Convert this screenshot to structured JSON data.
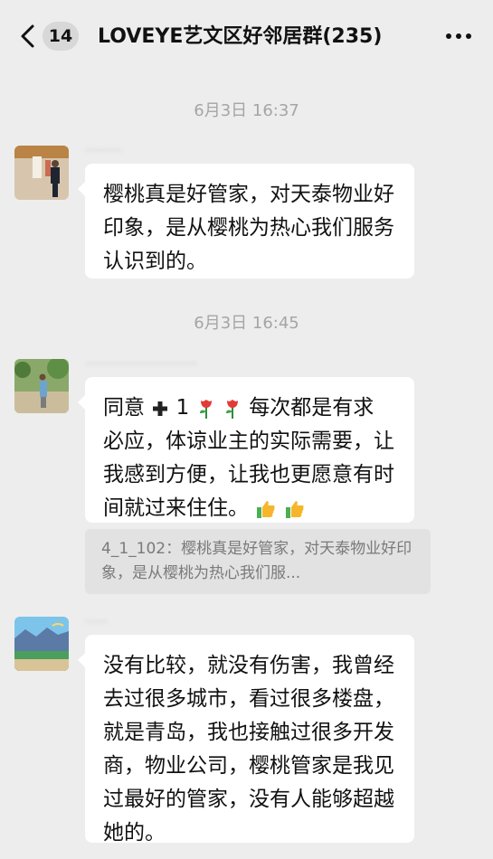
{
  "header": {
    "unread_count": "14",
    "title": "LOVEYE艺文区好邻居群(235)"
  },
  "messages": [
    {
      "timestamp": "6月3日 16:37",
      "sender": "..........",
      "text": "樱桃真是好管家，对天泰物业好印象，是从樱桃为热心我们服务认识到的。"
    },
    {
      "timestamp": "6月3日 16:45",
      "sender": "..............................",
      "text_part1": "同意",
      "text_part2": "1",
      "text_part3": "每次都是有求必应，体谅业主的实际需要，让我感到方便，让我也更愿意有时间就过来住住。",
      "quote": "4_1_102：樱桃真是好管家，对天泰物业好印象，是从樱桃为热心我们服..."
    },
    {
      "sender": "......",
      "text": "没有比较，就没有伤害，我曾经去过很多城市，看过很多楼盘，就是青岛，我也接触过很多开发商，物业公司，樱桃管家是我见过最好的管家，没有人能够超越她的。"
    }
  ],
  "icons": {
    "back": "chevron-left-icon",
    "more": "more-dots-icon",
    "plus": "plus-emoji-icon",
    "rose": "rose-emoji-icon",
    "thumbs": "thumbs-up-emoji-icon"
  }
}
